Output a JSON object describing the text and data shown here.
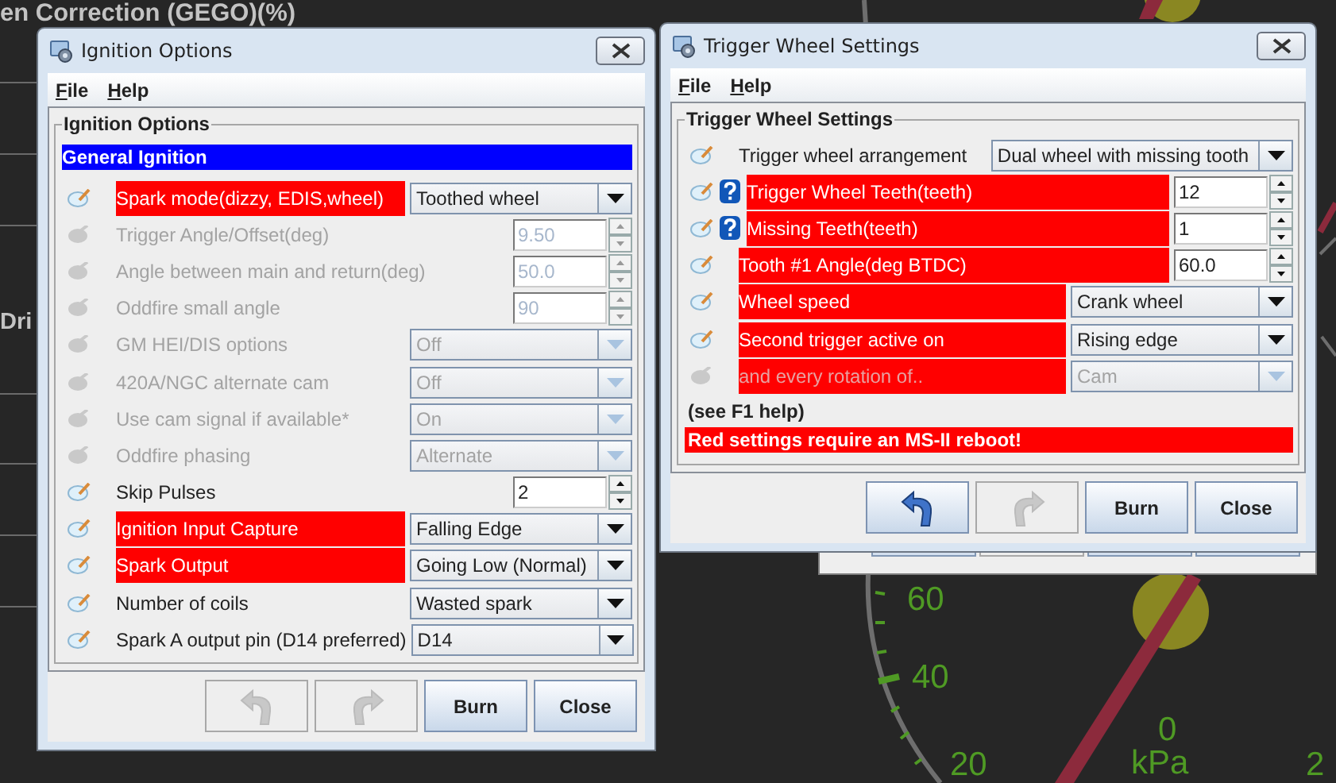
{
  "background": {
    "title": "en Correction (GEGO)(%)",
    "side_label": "Dri",
    "gauge": {
      "scale_labels": [
        "60",
        "40",
        "20"
      ],
      "center_value": "0",
      "unit": "kPa",
      "edge_label": "2"
    }
  },
  "windows": [
    {
      "title": "Ignition Options",
      "menu": [
        "File",
        "Help"
      ],
      "group_title": "Ignition Options",
      "section": "General Ignition",
      "rows": [
        {
          "kind": "combo",
          "label": "Spark mode(dizzy, EDIS,wheel)",
          "value": "Toothed wheel",
          "highlighted": true,
          "disabled": false,
          "help": false
        },
        {
          "kind": "spin",
          "label": "Trigger Angle/Offset(deg)",
          "value": "9.50",
          "highlighted": false,
          "disabled": true,
          "help": false
        },
        {
          "kind": "spin",
          "label": "Angle between main and return(deg)",
          "value": "50.0",
          "highlighted": false,
          "disabled": true,
          "help": false
        },
        {
          "kind": "spin",
          "label": "Oddfire small angle",
          "value": "90",
          "highlighted": false,
          "disabled": true,
          "help": false
        },
        {
          "kind": "combo",
          "label": "GM HEI/DIS options",
          "value": "Off",
          "highlighted": false,
          "disabled": true,
          "help": false
        },
        {
          "kind": "combo",
          "label": "420A/NGC alternate cam",
          "value": "Off",
          "highlighted": false,
          "disabled": true,
          "help": false
        },
        {
          "kind": "combo",
          "label": "Use cam signal if available*",
          "value": "On",
          "highlighted": false,
          "disabled": true,
          "help": false
        },
        {
          "kind": "combo",
          "label": "Oddfire phasing",
          "value": "Alternate",
          "highlighted": false,
          "disabled": true,
          "help": false
        },
        {
          "kind": "spin",
          "label": "Skip Pulses",
          "value": "2",
          "highlighted": false,
          "disabled": false,
          "help": false
        },
        {
          "kind": "combo",
          "label": "Ignition Input Capture",
          "value": "Falling Edge",
          "highlighted": true,
          "disabled": false,
          "help": false
        },
        {
          "kind": "combo",
          "label": "Spark Output",
          "value": "Going Low (Normal)",
          "highlighted": true,
          "disabled": false,
          "help": false
        },
        {
          "kind": "combo",
          "label": "Number of coils",
          "value": "Wasted spark",
          "highlighted": false,
          "disabled": false,
          "help": false
        },
        {
          "kind": "combo",
          "label": "Spark A output pin (D14 preferred)",
          "value": "D14",
          "highlighted": false,
          "disabled": false,
          "help": false
        }
      ],
      "buttons": [
        {
          "kind": "undo",
          "disabled": true
        },
        {
          "kind": "redo",
          "disabled": true
        },
        {
          "kind": "text",
          "label": "Burn",
          "disabled": false
        },
        {
          "kind": "text",
          "label": "Close",
          "disabled": false
        }
      ]
    },
    {
      "title": "Trigger Wheel Settings",
      "menu": [
        "File",
        "Help"
      ],
      "group_title": "Trigger Wheel Settings",
      "rows": [
        {
          "kind": "combo",
          "label": "Trigger wheel arrangement",
          "value": "Dual wheel with missing tooth",
          "highlighted": false,
          "disabled": false,
          "help": false
        },
        {
          "kind": "spin",
          "label": "Trigger Wheel Teeth(teeth)",
          "value": "12",
          "highlighted": true,
          "disabled": false,
          "help": true
        },
        {
          "kind": "spin",
          "label": "Missing Teeth(teeth)",
          "value": "1",
          "highlighted": true,
          "disabled": false,
          "help": true
        },
        {
          "kind": "spin",
          "label": "Tooth #1 Angle(deg BTDC)",
          "value": "60.0",
          "highlighted": true,
          "disabled": false,
          "help": false
        },
        {
          "kind": "combo",
          "label": "Wheel speed",
          "value": "Crank wheel",
          "highlighted": true,
          "disabled": false,
          "help": false
        },
        {
          "kind": "combo",
          "label": "Second trigger active on",
          "value": "Rising edge",
          "highlighted": true,
          "disabled": false,
          "help": false
        },
        {
          "kind": "combo",
          "label": "and every rotation of..",
          "value": "Cam",
          "highlighted": true,
          "disabled": true,
          "help": false
        }
      ],
      "note": "(see F1 help)",
      "warning": "Red settings require an MS-II reboot!",
      "buttons": [
        {
          "kind": "undo",
          "disabled": false
        },
        {
          "kind": "redo",
          "disabled": true
        },
        {
          "kind": "text",
          "label": "Burn",
          "disabled": false
        },
        {
          "kind": "text",
          "label": "Close",
          "disabled": false
        }
      ]
    }
  ]
}
